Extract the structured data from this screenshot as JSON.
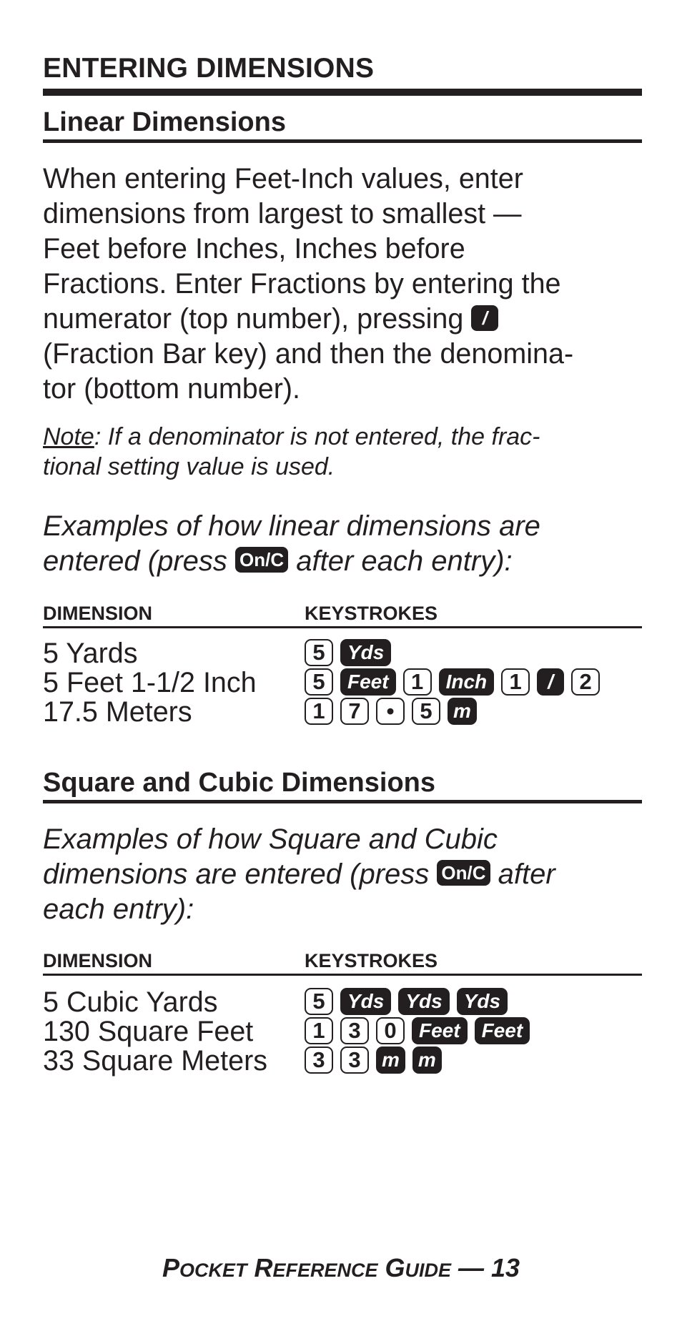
{
  "page_title": "ENTERING DIMENSIONS",
  "section_linear": {
    "heading": "Linear Dimensions",
    "paragraph": {
      "line1": "When entering Feet-Inch values, enter",
      "line2": "dimensions from largest to smallest —",
      "line3": "Feet before Inches, Inches before",
      "line4": "Fractions. Enter Fractions by entering the",
      "line5_before": "numerator (top number), pressing",
      "line5_key": "/",
      "line6": "(Fraction Bar key) and then the denomina-",
      "line7": "tor (bottom number)."
    },
    "note": {
      "label": "Note",
      "line1": ": If a denominator is not entered, the frac-",
      "line2": "tional setting value is used."
    },
    "examples_intro": {
      "line1": "Examples of how linear dimensions are",
      "line2_before": "entered (press",
      "line2_key": "On/C",
      "line2_after": "after each entry):"
    },
    "table": {
      "col_dimension": "DIMENSION",
      "col_keystrokes": "KEYSTROKES",
      "rows": [
        {
          "dimension": "5 Yards",
          "keys": [
            {
              "label": "5",
              "type": "num"
            },
            {
              "label": "Yds",
              "type": "fn"
            }
          ]
        },
        {
          "dimension": "5 Feet 1-1/2 Inch",
          "keys": [
            {
              "label": "5",
              "type": "num"
            },
            {
              "label": "Feet",
              "type": "fn"
            },
            {
              "label": "1",
              "type": "num"
            },
            {
              "label": "Inch",
              "type": "fn"
            },
            {
              "label": "1",
              "type": "num"
            },
            {
              "label": "/",
              "type": "fn"
            },
            {
              "label": "2",
              "type": "num"
            }
          ]
        },
        {
          "dimension": "17.5 Meters",
          "keys": [
            {
              "label": "1",
              "type": "num"
            },
            {
              "label": "7",
              "type": "num"
            },
            {
              "label": "•",
              "type": "num"
            },
            {
              "label": "5",
              "type": "num"
            },
            {
              "label": "m",
              "type": "fn"
            }
          ]
        }
      ]
    }
  },
  "section_square_cubic": {
    "heading": "Square and Cubic Dimensions",
    "examples_intro": {
      "line1": "Examples of how Square and Cubic",
      "line2_before": "dimensions are entered (press",
      "line2_key": "On/C",
      "line2_after": "after",
      "line3": "each entry):"
    },
    "table": {
      "col_dimension": "DIMENSION",
      "col_keystrokes": "KEYSTROKES",
      "rows": [
        {
          "dimension": "5 Cubic Yards",
          "keys": [
            {
              "label": "5",
              "type": "num"
            },
            {
              "label": "Yds",
              "type": "fn"
            },
            {
              "label": "Yds",
              "type": "fn"
            },
            {
              "label": "Yds",
              "type": "fn"
            }
          ]
        },
        {
          "dimension": "130 Square Feet",
          "keys": [
            {
              "label": "1",
              "type": "num"
            },
            {
              "label": "3",
              "type": "num"
            },
            {
              "label": "0",
              "type": "num"
            },
            {
              "label": "Feet",
              "type": "fn"
            },
            {
              "label": "Feet",
              "type": "fn"
            }
          ]
        },
        {
          "dimension": "33 Square Meters",
          "keys": [
            {
              "label": "3",
              "type": "num"
            },
            {
              "label": "3",
              "type": "num"
            },
            {
              "label": "m",
              "type": "fn"
            },
            {
              "label": "m",
              "type": "fn"
            }
          ]
        }
      ]
    }
  },
  "footer": {
    "p": "P",
    "ocket": "OCKET",
    "r": " R",
    "eference": "EFERENCE",
    "g": " G",
    "uide": "UIDE",
    "suffix": " — 13"
  }
}
